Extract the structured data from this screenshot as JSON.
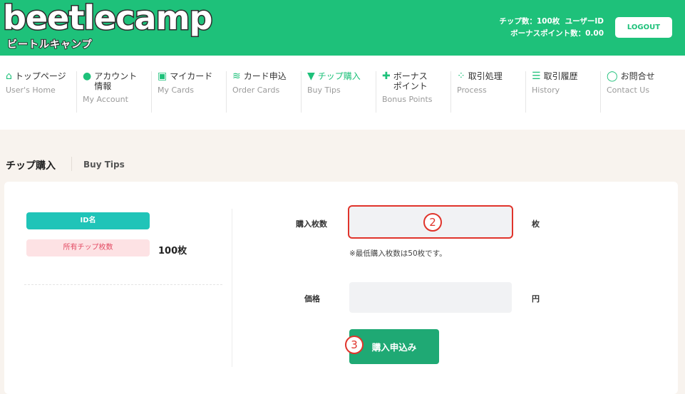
{
  "header": {
    "logo_text": "beetlecamp",
    "logo_subtext": "ビートルキャンプ",
    "chip_count": "チップ数：100枚",
    "user_id_label": "ユーザーID",
    "bonus_points": "ボーナスポイント数：0.00",
    "logout_label": "LOGOUT"
  },
  "nav": {
    "items": [
      {
        "icon": "home-icon",
        "glyph": "⌂",
        "jp": "トップページ",
        "en": "User's Home"
      },
      {
        "icon": "user-icon",
        "glyph": "●",
        "jp1": "アカウント",
        "jp2": "情報",
        "en": "My Account"
      },
      {
        "icon": "cards-icon",
        "glyph": "▣",
        "jp": "マイカード",
        "en": "My Cards"
      },
      {
        "icon": "coins-icon",
        "glyph": "≋",
        "jp": "カード申込",
        "en": "Order Cards"
      },
      {
        "icon": "cart-icon",
        "glyph": "▼",
        "jp": "チップ購入",
        "en": "Buy Tips"
      },
      {
        "icon": "gift-icon",
        "glyph": "✚",
        "jp1": "ボーナス",
        "jp2": "ポイント",
        "en": "Bonus Points"
      },
      {
        "icon": "spinner-icon",
        "glyph": "⁘",
        "jp": "取引処理",
        "en": "Process"
      },
      {
        "icon": "list-icon",
        "glyph": "☰",
        "jp": "取引履歴",
        "en": "History"
      },
      {
        "icon": "chat-icon",
        "glyph": "◯",
        "jp": "お問合せ",
        "en": "Contact Us"
      }
    ],
    "active_color": "#1ec17a"
  },
  "page": {
    "title": "チップ購入",
    "subtitle": "Buy Tips"
  },
  "account": {
    "id_label": "ID名",
    "chips_label": "所有チップ枚数",
    "chips_value": "100枚"
  },
  "form": {
    "quantity_label": "購入枚数",
    "quantity_value": "",
    "quantity_unit": "枚",
    "quantity_hint": "※最低購入枚数は50枚です。",
    "price_label": "価格",
    "price_value": "",
    "price_unit": "円",
    "submit_label": "購入申込み"
  },
  "annotations": {
    "quantity_marker": "2",
    "submit_marker": "3"
  },
  "colors": {
    "brand": "#1ec17a",
    "teal": "#20c4b8",
    "pink_bg": "#fde2e4",
    "pink_text": "#e34b63",
    "button": "#1fa974",
    "marker": "#e0342b"
  }
}
